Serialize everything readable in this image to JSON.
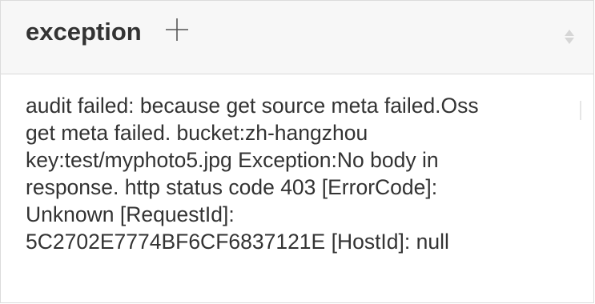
{
  "header": {
    "title": "exception",
    "add_icon": "plus-icon",
    "sort_icon": "sort-diamond-icon"
  },
  "cell": {
    "text": "audit failed: because get source meta failed.Oss\nget meta failed. bucket:zh-hangzhou\nkey:test/myphoto5.jpg Exception:No body in\nresponse. http status code 403 [ErrorCode]:\nUnknown [RequestId]:\n5C2702E7774BF6CF6837121E [HostId]: null"
  },
  "colors": {
    "header_bg": "#f7f7f7",
    "border": "#d9d9d9",
    "text": "#333333"
  }
}
